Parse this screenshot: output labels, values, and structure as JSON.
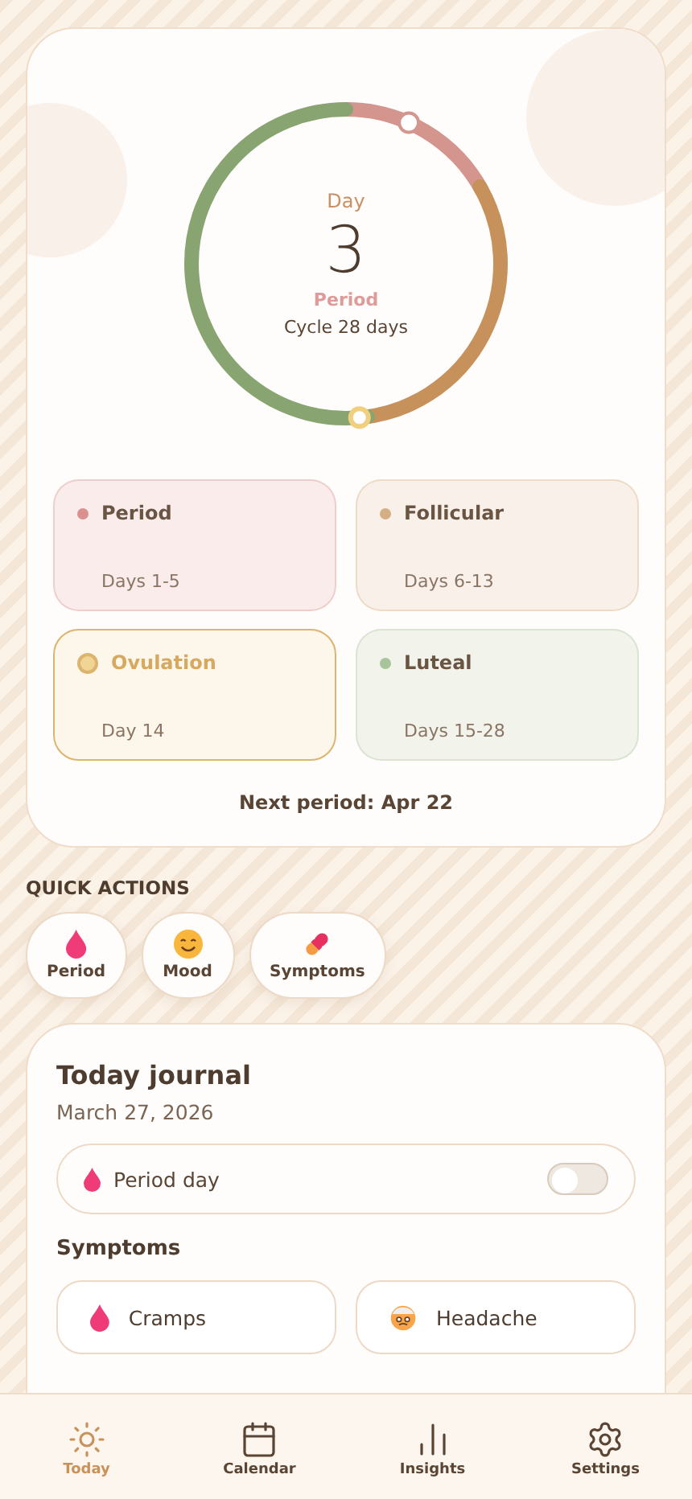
{
  "cycle": {
    "day_label": "Day",
    "day": "3",
    "phase": "Period",
    "length": "Cycle 28 days"
  },
  "phases": [
    {
      "name": "Period",
      "days": "Days 1-5",
      "color": "#d9908e",
      "outlined": false
    },
    {
      "name": "Follicular",
      "days": "Days 6-13",
      "color": "#d4ae85",
      "outlined": false
    },
    {
      "name": "Ovulation",
      "days": "Day 14",
      "color": "#f0d594",
      "outlined": true
    },
    {
      "name": "Luteal",
      "days": "Days 15-28",
      "color": "#a9c49a",
      "outlined": false
    }
  ],
  "next_period": "Next period: Apr 22",
  "quick_actions": {
    "title": "QUICK ACTIONS",
    "items": [
      {
        "label": "Period",
        "kind": "drop"
      },
      {
        "label": "Mood",
        "kind": "smile"
      },
      {
        "label": "Symptoms",
        "kind": "pill"
      }
    ]
  },
  "journal": {
    "title": "Today journal",
    "date": "March 27, 2026",
    "period_day": {
      "label": "Period day",
      "on": false
    },
    "symptoms_title": "Symptoms",
    "symptoms": [
      {
        "label": "Cramps",
        "kind": "drop"
      },
      {
        "label": "Headache",
        "kind": "hurt"
      }
    ]
  },
  "nav": [
    {
      "label": "Today",
      "kind": "sun",
      "selected": true
    },
    {
      "label": "Calendar",
      "kind": "calendar",
      "selected": false
    },
    {
      "label": "Insights",
      "kind": "bars",
      "selected": false
    },
    {
      "label": "Settings",
      "kind": "gear",
      "selected": false
    }
  ]
}
